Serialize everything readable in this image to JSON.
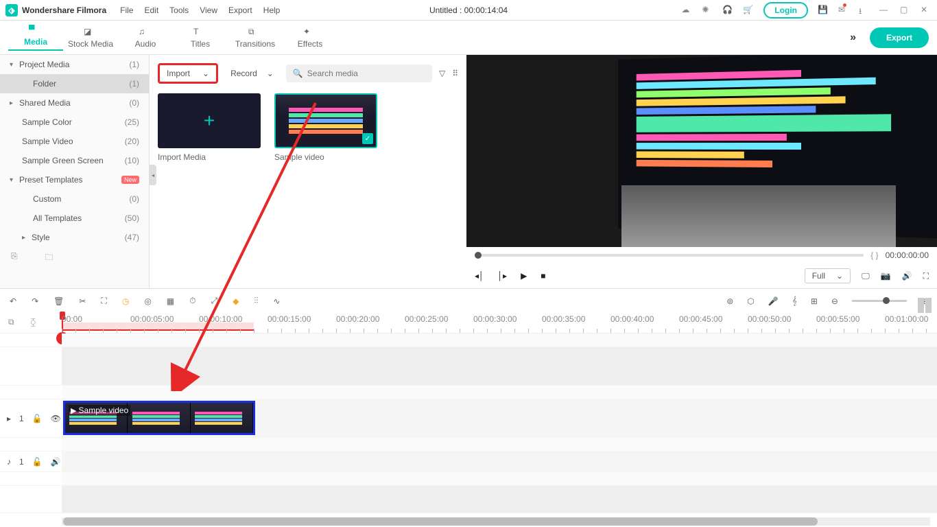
{
  "app": {
    "name": "Wondershare Filmora"
  },
  "menu": [
    "File",
    "Edit",
    "Tools",
    "View",
    "Export",
    "Help"
  ],
  "document": {
    "title": "Untitled : 00:00:14:04"
  },
  "titlebar": {
    "login": "Login"
  },
  "tabs": {
    "items": [
      {
        "label": "Media",
        "active": true
      },
      {
        "label": "Stock Media"
      },
      {
        "label": "Audio"
      },
      {
        "label": "Titles"
      },
      {
        "label": "Transitions"
      },
      {
        "label": "Effects"
      }
    ],
    "export": "Export"
  },
  "sidebar": {
    "items": [
      {
        "label": "Project Media",
        "count": "(1)",
        "arrow": "▾"
      },
      {
        "label": "Folder",
        "count": "(1)",
        "selected": true,
        "level": 2
      },
      {
        "label": "Shared Media",
        "count": "(0)",
        "arrow": "▸"
      },
      {
        "label": "Sample Color",
        "count": "(25)",
        "level": 1
      },
      {
        "label": "Sample Video",
        "count": "(20)",
        "level": 1
      },
      {
        "label": "Sample Green Screen",
        "count": "(10)",
        "level": 1
      },
      {
        "label": "Preset Templates",
        "arrow": "▾",
        "badge": "New"
      },
      {
        "label": "Custom",
        "count": "(0)",
        "level": 2
      },
      {
        "label": "All Templates",
        "count": "(50)",
        "level": 2
      },
      {
        "label": "Style",
        "count": "(47)",
        "arrow": "▸",
        "level": 2
      }
    ]
  },
  "mediaPanel": {
    "import": "Import",
    "record": "Record",
    "searchPlaceholder": "Search media",
    "thumb1": "Import Media",
    "thumb2": "Sample video"
  },
  "preview": {
    "timecode": "00:00:00:00",
    "brackets": "{        }",
    "fullLabel": "Full"
  },
  "ruler": {
    "marks": [
      "00:00",
      "00:00:05:00",
      "00:00:10:00",
      "00:00:15:00",
      "00:00:20:00",
      "00:00:25:00",
      "00:00:30:00",
      "00:00:35:00",
      "00:00:40:00",
      "00:00:45:00",
      "00:00:50:00",
      "00:00:55:00",
      "00:01:00:00"
    ]
  },
  "tracks": {
    "video": "1",
    "audio": "1"
  },
  "clip": {
    "name": "Sample video"
  }
}
